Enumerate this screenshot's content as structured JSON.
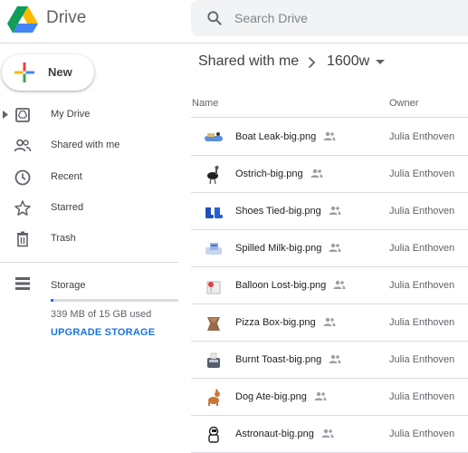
{
  "header": {
    "brand": "Drive",
    "search_placeholder": "Search Drive"
  },
  "sidebar": {
    "new_label": "New",
    "items": [
      {
        "label": "My Drive",
        "icon": "my-drive-icon"
      },
      {
        "label": "Shared with me",
        "icon": "people-icon"
      },
      {
        "label": "Recent",
        "icon": "clock-icon"
      },
      {
        "label": "Starred",
        "icon": "star-icon"
      },
      {
        "label": "Trash",
        "icon": "trash-icon"
      }
    ],
    "storage": {
      "label": "Storage",
      "used_text": "339 MB of 15 GB used",
      "used_fraction": 0.022,
      "upgrade_label": "UPGRADE STORAGE"
    }
  },
  "main": {
    "breadcrumb": {
      "root": "Shared with me",
      "current": "1600w"
    },
    "columns": {
      "name": "Name",
      "owner": "Owner"
    },
    "files": [
      {
        "name": "Boat Leak-big.png",
        "owner": "Julia Enthoven",
        "thumb": "boat-thumbnail"
      },
      {
        "name": "Ostrich-big.png",
        "owner": "Julia Enthoven",
        "thumb": "ostrich-thumbnail"
      },
      {
        "name": "Shoes Tied-big.png",
        "owner": "Julia Enthoven",
        "thumb": "shoes-thumbnail"
      },
      {
        "name": "Spilled Milk-big.png",
        "owner": "Julia Enthoven",
        "thumb": "spilled-milk-thumbnail"
      },
      {
        "name": "Balloon Lost-big.png",
        "owner": "Julia Enthoven",
        "thumb": "balloon-thumbnail"
      },
      {
        "name": "Pizza Box-big.png",
        "owner": "Julia Enthoven",
        "thumb": "pizza-box-thumbnail"
      },
      {
        "name": "Burnt Toast-big.png",
        "owner": "Julia Enthoven",
        "thumb": "toaster-thumbnail"
      },
      {
        "name": "Dog Ate-big.png",
        "owner": "Julia Enthoven",
        "thumb": "dog-thumbnail"
      },
      {
        "name": "Astronaut-big.png",
        "owner": "Julia Enthoven",
        "thumb": "astronaut-thumbnail"
      }
    ]
  },
  "colors": {
    "accent": "#1a73e8",
    "divider": "#dadce0",
    "search_bg": "#f1f3f4"
  }
}
